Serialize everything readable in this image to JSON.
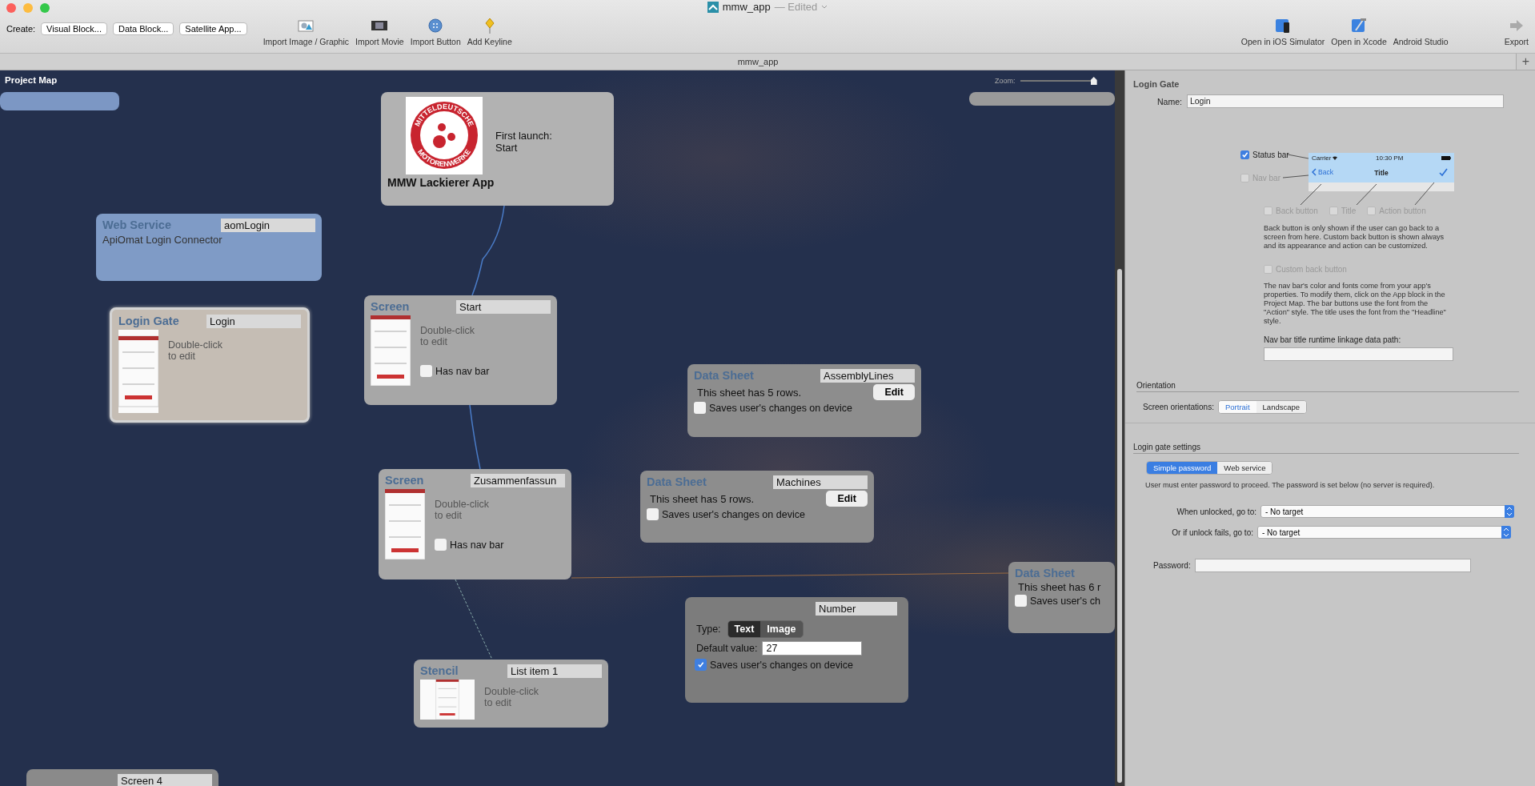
{
  "window": {
    "title": "mmw_app",
    "status": "— Edited"
  },
  "toolbar": {
    "create_label": "Create:",
    "create_buttons": [
      "Visual Block...",
      "Data Block...",
      "Satellite App..."
    ],
    "tools": [
      {
        "kind": "image",
        "label": "Import Image / Graphic"
      },
      {
        "kind": "movie",
        "label": "Import Movie"
      },
      {
        "kind": "button",
        "label": "Import Button"
      },
      {
        "kind": "keyline",
        "label": "Add Keyline"
      }
    ],
    "right_tools": [
      {
        "kind": "simulator",
        "label": "Open in iOS Simulator"
      },
      {
        "kind": "xcode",
        "label": "Open in Xcode"
      },
      {
        "kind": "none",
        "label": "Android Studio"
      },
      {
        "kind": "export",
        "label": "Export"
      }
    ]
  },
  "tab_bar": {
    "tab": "mmw_app",
    "add_button": "+"
  },
  "project_map": {
    "title": "Project Map",
    "zoom_label": "Zoom:",
    "zoom": {
      "level": 0.97
    },
    "blocks": [
      {
        "kind": "stub",
        "selected": false
      },
      {
        "kind": "app",
        "selected": false,
        "logo_top": "MITTELDEUTSCHE",
        "logo_bottom": "MOTORENWERKE",
        "launch_label": "First launch:",
        "launch_target": "Start",
        "name": "MMW Lackierer App"
      },
      {
        "kind": "stub",
        "selected": false
      },
      {
        "kind": "web_service",
        "selected": false,
        "title": "Web Service",
        "name": "aomLogin",
        "description": "ApiOmat Login Connector"
      },
      {
        "kind": "gate",
        "selected": true,
        "title": "Login Gate",
        "name": "Login",
        "hint": "Double-click\nto edit"
      },
      {
        "kind": "screen",
        "selected": false,
        "title": "Screen",
        "name": "Start",
        "hint": "Double-click\nto edit",
        "nav_label": "Has nav bar",
        "has_nav_bar": false
      },
      {
        "kind": "data_sheet",
        "selected": false,
        "title": "Data Sheet",
        "name": "AssemblyLines",
        "rows_text": "This sheet has 5 rows.",
        "edit_button": "Edit",
        "saves_label": "Saves user's changes on device",
        "saves": false
      },
      {
        "kind": "screen",
        "selected": false,
        "title": "Screen",
        "name": "Zusammenfassun",
        "hint": "Double-click\nto edit",
        "nav_label": "Has nav bar",
        "has_nav_bar": false
      },
      {
        "kind": "data_sheet",
        "selected": false,
        "title": "Data Sheet",
        "name": "Machines",
        "rows_text": "This sheet has 5 rows.",
        "edit_button": "Edit",
        "saves_label": "Saves user's changes on device",
        "saves": false
      },
      {
        "kind": "data_sheet",
        "selected": false,
        "title": "Data Sheet",
        "rows_text": "This sheet has 6 r",
        "saves_label": "Saves user's ch",
        "saves": false
      },
      {
        "kind": "variable",
        "selected": false,
        "name": "Number",
        "type_label": "Type:",
        "types": [
          {
            "label": "Text",
            "selected": true
          },
          {
            "label": "Image",
            "selected": false
          }
        ],
        "default_label": "Default value:",
        "default_value": "27",
        "saves_label": "Saves user's changes on device",
        "saves": true
      },
      {
        "kind": "stencil",
        "selected": false,
        "title": "Stencil",
        "name": "List item 1",
        "hint": "Double-click\nto edit"
      },
      {
        "kind": "stub_named",
        "selected": false,
        "name": "Screen 4"
      }
    ]
  },
  "inspector": {
    "title": "Login Gate",
    "name_label": "Name:",
    "name_value": "Login",
    "status_bar": {
      "label": "Status bar",
      "checked": true,
      "disabled": false
    },
    "nav_bar": {
      "label": "Nav bar",
      "checked": false,
      "disabled": true
    },
    "preview": {
      "carrier": "Carrier",
      "time": "10:30 PM",
      "back": "Back",
      "title": "Title"
    },
    "nav_options": [
      {
        "label": "Back button",
        "checked": false,
        "disabled": true
      },
      {
        "label": "Title",
        "checked": false,
        "disabled": true
      },
      {
        "label": "Action button",
        "checked": false,
        "disabled": true
      }
    ],
    "back_note": "Back button is only shown if the user can go back to a screen from here. Custom back button is shown always and its appearance and action can be customized.",
    "custom_back": {
      "label": "Custom back button",
      "checked": false,
      "disabled": true
    },
    "nav_note": "The nav bar's color and fonts come from your app's properties. To modify them, click on the App block in the Project Map. The bar buttons use the font from the \"Action\" style. The title uses the font from the \"Headline\" style.",
    "linkage_label": "Nav bar title runtime linkage data path:",
    "orientation_heading": "Orientation",
    "orientations_label": "Screen orientations:",
    "orientations": [
      {
        "label": "Portrait",
        "selected": true
      },
      {
        "label": "Landscape",
        "selected": false
      }
    ],
    "gate_heading": "Login gate settings",
    "modes": [
      {
        "label": "Simple password",
        "selected": true
      },
      {
        "label": "Web service",
        "selected": false
      }
    ],
    "mode_note": "User must enter password to proceed. The password is set below (no server is required).",
    "targets": [
      {
        "label": "When unlocked, go to:",
        "value": "- No target"
      },
      {
        "label": "Or if unlock fails, go to:",
        "value": "- No target"
      }
    ],
    "password_label": "Password:"
  }
}
